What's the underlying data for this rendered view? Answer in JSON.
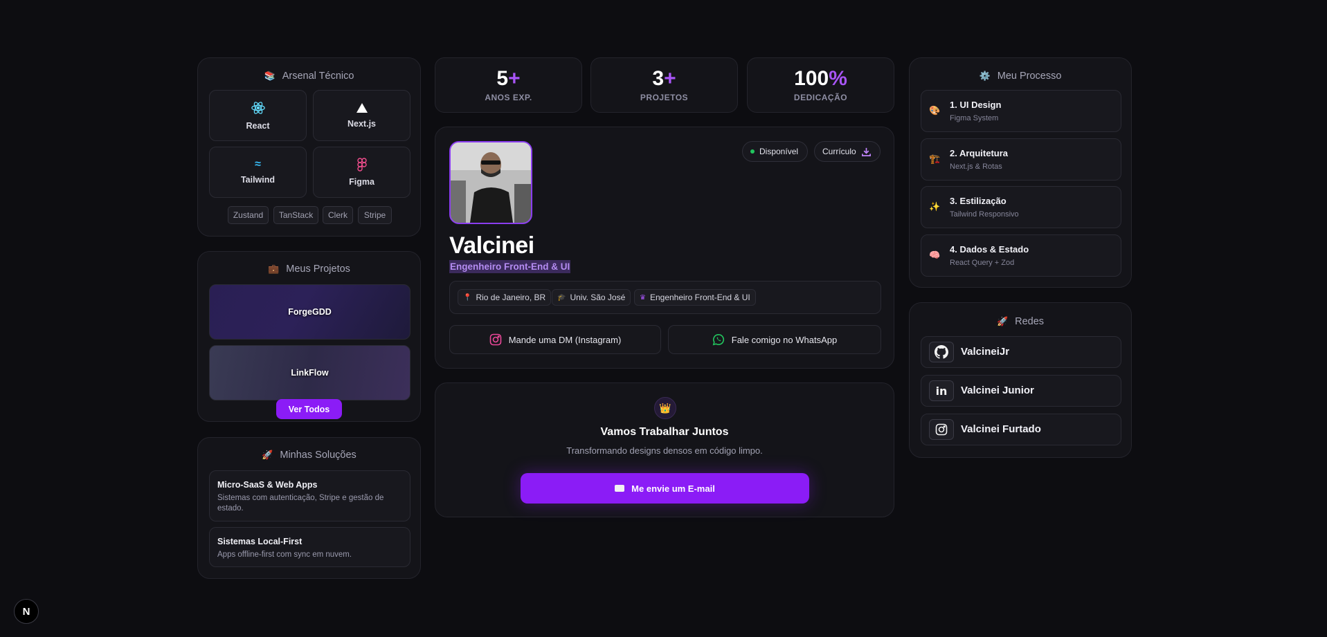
{
  "arsenal": {
    "title": "Arsenal Técnico",
    "icon": "books-icon",
    "tech": [
      {
        "label": "React",
        "icon": "react-icon"
      },
      {
        "label": "Next.js",
        "icon": "triangle-icon"
      },
      {
        "label": "Tailwind",
        "icon": "tailwind-icon"
      },
      {
        "label": "Figma",
        "icon": "figma-icon"
      }
    ],
    "chips": [
      "Zustand",
      "TanStack",
      "Clerk",
      "Stripe"
    ]
  },
  "projects": {
    "title": "Meus Projetos",
    "icon": "briefcase-icon",
    "items": [
      {
        "label": "ForgeGDD"
      },
      {
        "label": "LinkFlow"
      }
    ],
    "view_all": "Ver Todos"
  },
  "solutions": {
    "title": "Minhas Soluções",
    "icon": "rocket-icon",
    "items": [
      {
        "title": "Micro-SaaS & Web Apps",
        "desc": "Sistemas com autenticação, Stripe e gestão de estado."
      },
      {
        "title": "Sistemas Local-First",
        "desc": "Apps offline-first com sync em nuvem."
      }
    ]
  },
  "stats": [
    {
      "num": "5",
      "suffix": "+",
      "label": "ANOS EXP."
    },
    {
      "num": "3",
      "suffix": "+",
      "label": "PROJETOS"
    },
    {
      "num": "100",
      "suffix": "%",
      "label": "DEDICAÇÃO"
    }
  ],
  "profile": {
    "name": "Valcinei",
    "role": "Engenheiro Front-End & UI",
    "status": "Disponível",
    "cv": "Currículo",
    "tags": [
      {
        "label": "Rio de Janeiro, BR",
        "icon": "pin-icon"
      },
      {
        "label": "Univ. São José",
        "icon": "graduation-cap-icon"
      },
      {
        "label": "Engenheiro Front-End & UI",
        "icon": "crown-icon"
      }
    ],
    "instagram_cta": "Mande uma DM (Instagram)",
    "whatsapp_cta": "Fale comigo no WhatsApp"
  },
  "contact": {
    "title": "Vamos Trabalhar Juntos",
    "subtitle": "Transformando designs densos em código limpo.",
    "button": "Me envie um E-mail"
  },
  "process": {
    "title": "Meu Processo",
    "icon": "gear-icon",
    "steps": [
      {
        "title": "1. UI Design",
        "sub": "Figma System",
        "icon": "palette-icon"
      },
      {
        "title": "2. Arquitetura",
        "sub": "Next.js & Rotas",
        "icon": "crane-icon"
      },
      {
        "title": "3. Estilização",
        "sub": "Tailwind Responsivo",
        "icon": "sparkles-icon"
      },
      {
        "title": "4. Dados & Estado",
        "sub": "React Query + Zod",
        "icon": "brain-icon"
      }
    ]
  },
  "networks": {
    "title": "Redes",
    "icon": "rocket-icon",
    "items": [
      {
        "label": "ValcineiJr",
        "icon": "github-icon"
      },
      {
        "label": "Valcinei Junior",
        "icon": "linkedin-icon"
      },
      {
        "label": "Valcinei Furtado",
        "icon": "instagram-icon"
      }
    ]
  },
  "nextjs_badge": "N",
  "colors": {
    "accent": "#8b1cf6",
    "accent_light": "#a855f7",
    "background": "#0d0d11",
    "card": "#141419",
    "status_dot": "#22c55e"
  }
}
